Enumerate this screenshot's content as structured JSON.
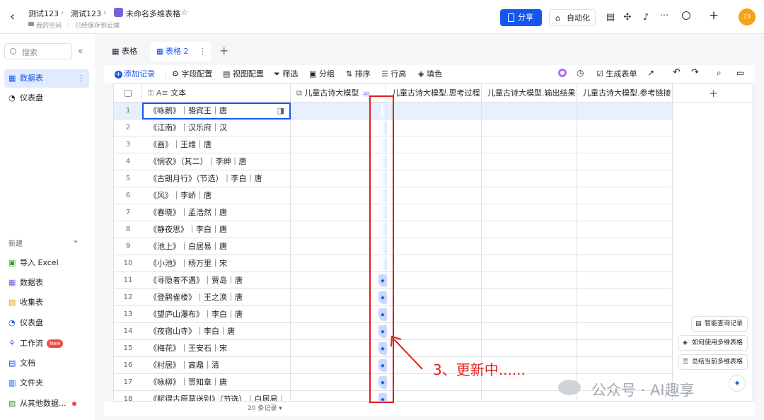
{
  "topbar": {
    "crumb1": "测试123",
    "crumb2": "测试123",
    "doc_title": "未命名多维表格",
    "loc1": "我的空间",
    "loc2": "已经保存到云端",
    "share": "分享",
    "automation": "自动化",
    "avatar": "23"
  },
  "sidebar": {
    "search_placeholder": "搜索",
    "items": [
      {
        "label": "数据表",
        "active": true
      },
      {
        "label": "仪表盘"
      }
    ],
    "new_label": "新建",
    "new_items": [
      {
        "label": "导入 Excel"
      },
      {
        "label": "数据表"
      },
      {
        "label": "收集表"
      },
      {
        "label": "仪表盘"
      },
      {
        "label": "工作流",
        "badge": "New"
      },
      {
        "label": "文档"
      },
      {
        "label": "文件夹"
      },
      {
        "label": "从其他数据..."
      }
    ]
  },
  "tabs": [
    {
      "label": "表格"
    },
    {
      "label": "表格 2"
    }
  ],
  "toolbar": {
    "add_record": "添加记录",
    "field_config": "字段配置",
    "view_config": "视图配置",
    "filter": "筛选",
    "group": "分组",
    "sort": "排序",
    "row_height": "行高",
    "fill_color": "填色",
    "gen_form": "生成表单"
  },
  "columns": {
    "text": "文本",
    "model": "儿童古诗大模型",
    "ai_badge": "AI",
    "thinking": "儿童古诗大模型.思考过程",
    "output": "儿童古诗大模型.输出结果",
    "refs": "儿童古诗大模型.参考链接"
  },
  "rows": [
    {
      "n": "1",
      "t": "《咏鹅》｜骆宾王｜唐"
    },
    {
      "n": "2",
      "t": "《江南》｜汉乐府｜汉"
    },
    {
      "n": "3",
      "t": "《画》｜王维｜唐"
    },
    {
      "n": "4",
      "t": "《悯农》（其二）｜李绅｜唐"
    },
    {
      "n": "5",
      "t": "《古朗月行》（节选）｜李白｜唐"
    },
    {
      "n": "6",
      "t": "《风》｜李峤｜唐"
    },
    {
      "n": "7",
      "t": "《春晓》｜孟浩然｜唐"
    },
    {
      "n": "8",
      "t": "《静夜思》｜李白｜唐"
    },
    {
      "n": "9",
      "t": "《池上》｜白居易｜唐"
    },
    {
      "n": "10",
      "t": "《小池》｜杨万里｜宋"
    },
    {
      "n": "11",
      "t": "《寻隐者不遇》｜贾岛｜唐"
    },
    {
      "n": "12",
      "t": "《登鹳雀楼》｜王之涣｜唐"
    },
    {
      "n": "13",
      "t": "《望庐山瀑布》｜李白｜唐"
    },
    {
      "n": "14",
      "t": "《夜宿山寺》｜李白｜唐"
    },
    {
      "n": "15",
      "t": "《梅花》｜王安石｜宋"
    },
    {
      "n": "16",
      "t": "《村居》｜高鼎｜清"
    },
    {
      "n": "17",
      "t": "《咏柳》｜贺知章｜唐"
    },
    {
      "n": "18",
      "t": "《赋得古原草送别》（节选）｜白居易｜"
    }
  ],
  "footer": {
    "count": "20 条记录"
  },
  "float_buttons": [
    {
      "label": "智能查询记录"
    },
    {
      "label": "如何使用多维表格"
    },
    {
      "label": "总结当前多维表格"
    }
  ],
  "annotation": {
    "label": "3、更新中......"
  },
  "watermark": {
    "label": "公众号 · AI趣享"
  },
  "colors": {
    "accent": "#1456f0",
    "annotation": "#e02020",
    "selected_row": "#e8effd"
  }
}
